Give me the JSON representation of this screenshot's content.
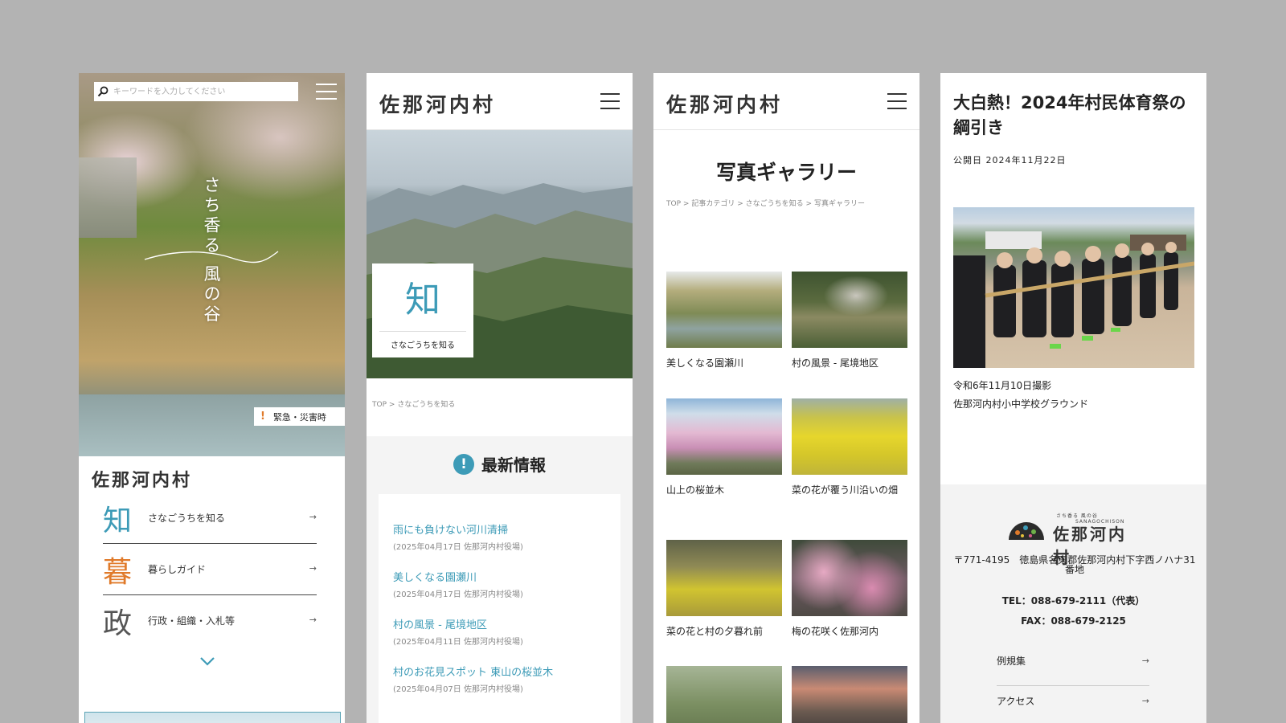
{
  "colors": {
    "accent": "#3d9bb7",
    "orange": "#e07a2a",
    "page_bg": "#b3b3b3",
    "text": "#222222"
  },
  "screen1": {
    "search_placeholder": "キーワードを入力してください",
    "tagline": "さち香る 風の谷",
    "emergency": {
      "icon": "!",
      "label": "緊急・災害時"
    },
    "logo": "佐那河内村",
    "menu": [
      {
        "kanji": "知",
        "label": "さなごうちを知る",
        "color": "#3d9bb7",
        "arrow": "→"
      },
      {
        "kanji": "暮",
        "label": "暮らしガイド",
        "color": "#e07a2a",
        "arrow": "→"
      },
      {
        "kanji": "政",
        "label": "行政・組織・入札等",
        "color": "#555555",
        "arrow": "→"
      }
    ]
  },
  "screen2": {
    "logo": "佐那河内村",
    "card": {
      "kanji": "知",
      "label": "さなごうちを知る"
    },
    "breadcrumb": {
      "top": "TOP",
      "sep": ">",
      "current": "さなごうちを知る"
    },
    "news": {
      "title": "最新情報",
      "icon": "!",
      "items": [
        {
          "title": "雨にも負けない河川清掃",
          "meta": "(2025年04月17日 佐那河内村役場)"
        },
        {
          "title": "美しくなる園瀬川",
          "meta": "(2025年04月17日 佐那河内村役場)"
        },
        {
          "title": "村の風景 - 尾境地区",
          "meta": "(2025年04月11日 佐那河内村役場)"
        },
        {
          "title": "村のお花見スポット 東山の桜並木",
          "meta": "(2025年04月07日 佐那河内村役場)"
        }
      ]
    }
  },
  "screen3": {
    "logo": "佐那河内村",
    "title": "写真ギャラリー",
    "breadcrumb": [
      "TOP",
      "記事カテゴリ",
      "さなごうちを知る",
      "写真ギャラリー"
    ],
    "breadcrumb_sep": ">",
    "gallery": [
      {
        "caption": "美しくなる園瀬川"
      },
      {
        "caption": "村の風景 - 尾境地区"
      },
      {
        "caption": "山上の桜並木"
      },
      {
        "caption": "菜の花が覆う川沿いの畑"
      },
      {
        "caption": "菜の花と村の夕暮れ前"
      },
      {
        "caption": "梅の花咲く佐那河内"
      },
      {
        "caption": ""
      },
      {
        "caption": ""
      }
    ]
  },
  "screen4": {
    "title": "大白熱！2024年村民体育祭の綱引き",
    "date_label": "公開日 2024年11月22日",
    "caption_line1": "令和6年11月10日撮影",
    "caption_line2": "佐那河内村小中学校グラウンド",
    "footer": {
      "logo_small": "さち香る 風の谷",
      "logo_roman": "SANAGOCHISON",
      "logo": "佐那河内村",
      "address": "〒771-4195　徳島県名東郡佐那河内村下字西ノハナ31番地",
      "tel": "TEL：088-679-2111（代表）",
      "fax": "FAX：088-679-2125",
      "links": [
        {
          "label": "例規集",
          "arrow": "→"
        },
        {
          "label": "アクセス",
          "arrow": "→"
        }
      ]
    }
  }
}
